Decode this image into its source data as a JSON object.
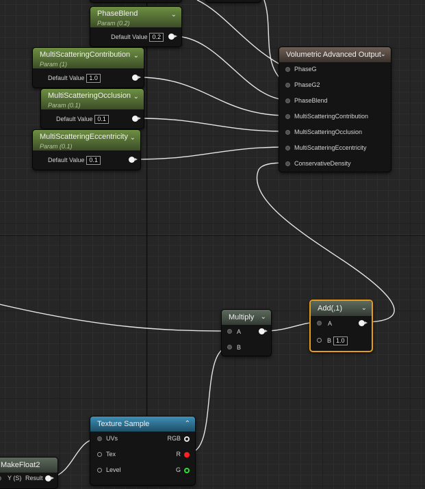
{
  "colors": {
    "background": "#262626",
    "param_header": "#6e8f43",
    "output_header": "#6e5f55",
    "math_header": "#5d6a5d",
    "texture_header": "#3f8fb6",
    "selection": "#e79d1c",
    "wire": "#e6e6e6",
    "pin_red": "#ff2020",
    "pin_green": "#2ee02e"
  },
  "phase_blend": {
    "title": "PhaseBlend",
    "subtitle": "Param (0.2)",
    "row_label": "Default Value",
    "value": "0.2",
    "icon": "chevron-down-icon"
  },
  "ms_contribution": {
    "title": "MultiScatteringContribution",
    "subtitle": "Param (1)",
    "row_label": "Default Value",
    "value": "1.0"
  },
  "ms_occlusion": {
    "title": "MultiScatteringOcclusion",
    "subtitle": "Param (0.1)",
    "row_label": "Default Value",
    "value": "0.1"
  },
  "ms_eccentricity": {
    "title": "MultiScatteringEccentricity",
    "subtitle": "Param (0.1)",
    "row_label": "Default Value",
    "value": "0.1"
  },
  "output": {
    "title": "Volumetric Advanced Output",
    "pins": [
      "PhaseG",
      "PhaseG2",
      "PhaseBlend",
      "MultiScatteringContribution",
      "MultiScatteringOcclusion",
      "MultiScatteringEccentricity",
      "ConservativeDensity"
    ]
  },
  "multiply": {
    "title": "Multiply",
    "pin_a": "A",
    "pin_b": "B"
  },
  "add": {
    "title": "Add(,1)",
    "pin_a": "A",
    "pin_b": "B",
    "b_value": "1.0"
  },
  "texture_sample": {
    "title": "Texture Sample",
    "inputs": [
      "UVs",
      "Tex",
      "Level"
    ],
    "outputs": [
      "RGB",
      "R",
      "G"
    ]
  },
  "make_float2": {
    "title": "MakeFloat2",
    "row_left": "Y (S)",
    "row_right": "Result"
  }
}
